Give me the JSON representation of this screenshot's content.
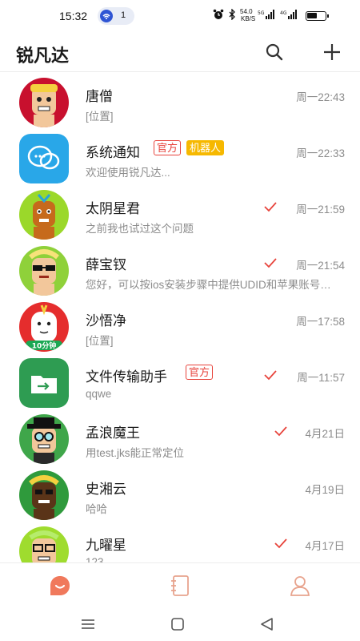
{
  "status_bar": {
    "time": "15:32",
    "notification_count": "1",
    "network_speed_value": "54.0",
    "network_speed_unit": "KB/S",
    "icons": [
      "alarm-icon",
      "bluetooth-icon",
      "signal-5g-icon",
      "signal-4g-icon",
      "battery-icon"
    ]
  },
  "header": {
    "title": "锐凡达",
    "search_icon": "search-icon",
    "add_icon": "plus-icon"
  },
  "chats": [
    {
      "name": "唐僧",
      "preview": "[位置]",
      "time": "周一22:43",
      "read": false,
      "tags": [],
      "avatar": "cartoon-avatar-red"
    },
    {
      "name": "系统通知",
      "preview": "欢迎使用锐凡达...",
      "time": "周一22:33",
      "read": false,
      "tags": [
        "官方",
        "机器人"
      ],
      "avatar": "chat-bubble-icon"
    },
    {
      "name": "太阴星君",
      "preview": "之前我也试过这个问题",
      "time": "周一21:59",
      "read": true,
      "tags": [],
      "avatar": "cartoon-avatar-green"
    },
    {
      "name": "薛宝钗",
      "preview": "您好，可以按ios安装步骤中提供UDID和苹果账号给我们",
      "time": "周一21:54",
      "read": true,
      "tags": [],
      "avatar": "cartoon-avatar-sunglasses"
    },
    {
      "name": "沙悟净",
      "preview": "[位置]",
      "time": "周一17:58",
      "read": false,
      "tags": [],
      "avatar": "cartoon-avatar-badge",
      "avatar_badge": "10分钟"
    },
    {
      "name": "文件传输助手",
      "preview": "qqwe",
      "time": "周一11:57",
      "read": true,
      "tags": [
        "官方"
      ],
      "avatar": "folder-transfer-icon"
    },
    {
      "name": "孟浪魔王",
      "preview": "用test.jks能正常定位",
      "time": "4月21日",
      "read": true,
      "tags": [],
      "avatar": "cartoon-avatar-hat"
    },
    {
      "name": "史湘云",
      "preview": "哈哈",
      "time": "4月19日",
      "read": false,
      "tags": [],
      "avatar": "cartoon-avatar-dark"
    },
    {
      "name": "九曜星",
      "preview": "123",
      "time": "4月17日",
      "read": true,
      "tags": [],
      "avatar": "cartoon-avatar-glasses"
    }
  ],
  "tabbar": {
    "items": [
      {
        "name": "messages",
        "icon": "chat-bubble-smile-icon",
        "active": true
      },
      {
        "name": "contacts",
        "icon": "address-book-icon",
        "active": false
      },
      {
        "name": "me",
        "icon": "person-icon",
        "active": false
      }
    ]
  },
  "system_nav": {
    "buttons": [
      "menu-icon",
      "home-icon",
      "back-icon"
    ]
  },
  "colors": {
    "accent": "#f0795c",
    "tag_official": "#e7433b",
    "tag_robot": "#f6b800",
    "check": "#e7433b",
    "muted_text": "#8c8c8c",
    "folder_green": "#2e9c52",
    "system_notice_blue": "#29a7e8"
  }
}
